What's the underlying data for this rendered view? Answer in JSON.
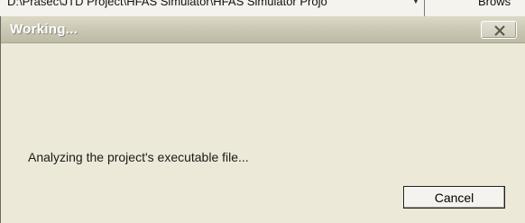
{
  "background_window": {
    "path_text": "D:\\Prasec\\JTD Project\\HFAS Simulator\\HFAS Simulator Projo",
    "browse_label": "Brows"
  },
  "dialog": {
    "title": "Working...",
    "message": "Analyzing the project's executable file...",
    "cancel_label": "Cancel",
    "close_icon": "close-icon"
  },
  "colors": {
    "dialog_bg": "#ece9d8",
    "titlebar": "#c9c6b3",
    "title_text": "#ffffff"
  }
}
